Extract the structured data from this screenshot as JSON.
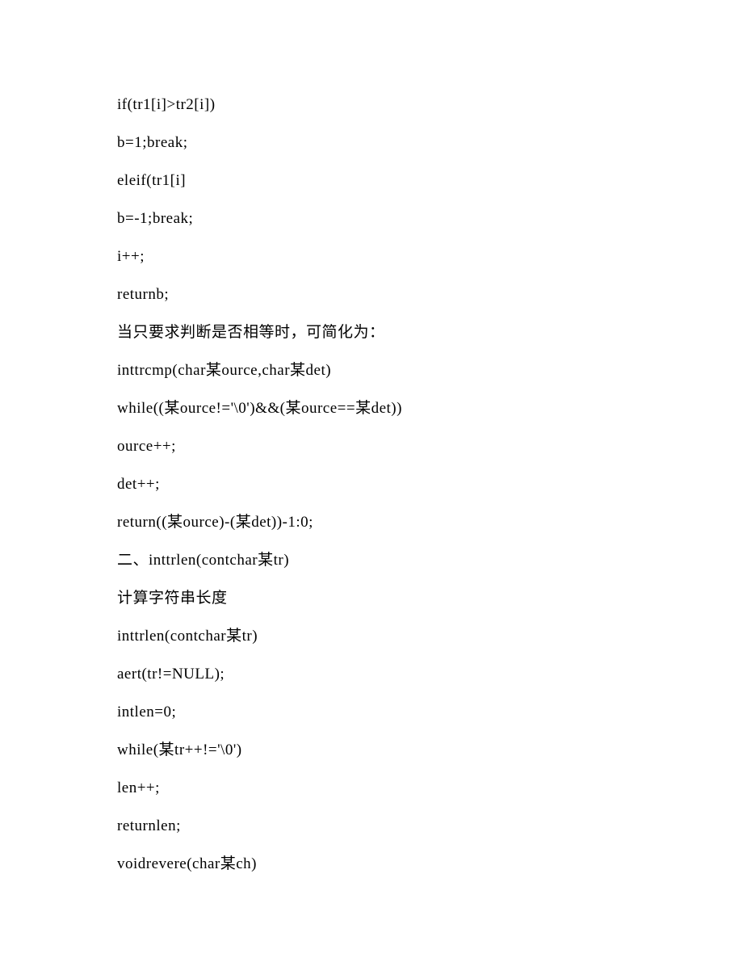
{
  "lines": [
    "if(tr1[i]>tr2[i])",
    "b=1;break;",
    "eleif(tr1[i]",
    "b=-1;break;",
    "i++;",
    "returnb;",
    "当只要求判断是否相等时，可简化为：",
    "inttrcmp(char某ource,char某det)",
    "while((某ource!='\\0')&&(某ource==某det))",
    "ource++;",
    "det++;",
    "return((某ource)-(某det))-1:0;",
    "二、inttrlen(contchar某tr)",
    "计算字符串长度",
    "inttrlen(contchar某tr)",
    "aert(tr!=NULL);",
    "intlen=0;",
    "while(某tr++!='\\0')",
    "len++;",
    "returnlen;",
    "voidrevere(char某ch)"
  ]
}
